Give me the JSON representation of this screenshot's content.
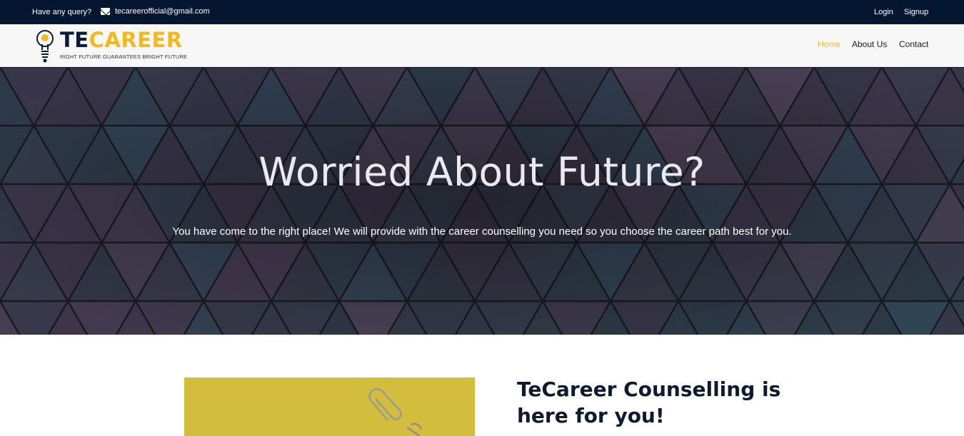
{
  "topbar": {
    "query_label": "Have any query?",
    "email": "tecareerofficial@gmail.com",
    "login_label": "Login",
    "signup_label": "Signup"
  },
  "logo": {
    "word_te": "TE",
    "word_career": "CAREER",
    "tagline": "RIGHT FUTURE GUARANTEES BRIGHT FUTURE"
  },
  "nav": {
    "items": [
      {
        "label": "Home",
        "active": true
      },
      {
        "label": "About Us",
        "active": false
      },
      {
        "label": "Contact",
        "active": false
      }
    ]
  },
  "hero": {
    "title": "Worried About Future?",
    "text": "You have come to the right place! We will provide with the career counselling you need so you choose the career path best for you."
  },
  "section": {
    "heading": "TeCareer Counselling is here for you!"
  },
  "colors": {
    "topbar_bg": "#051630",
    "accent": "#f6b91d",
    "brand_dark": "#0b1a36"
  }
}
